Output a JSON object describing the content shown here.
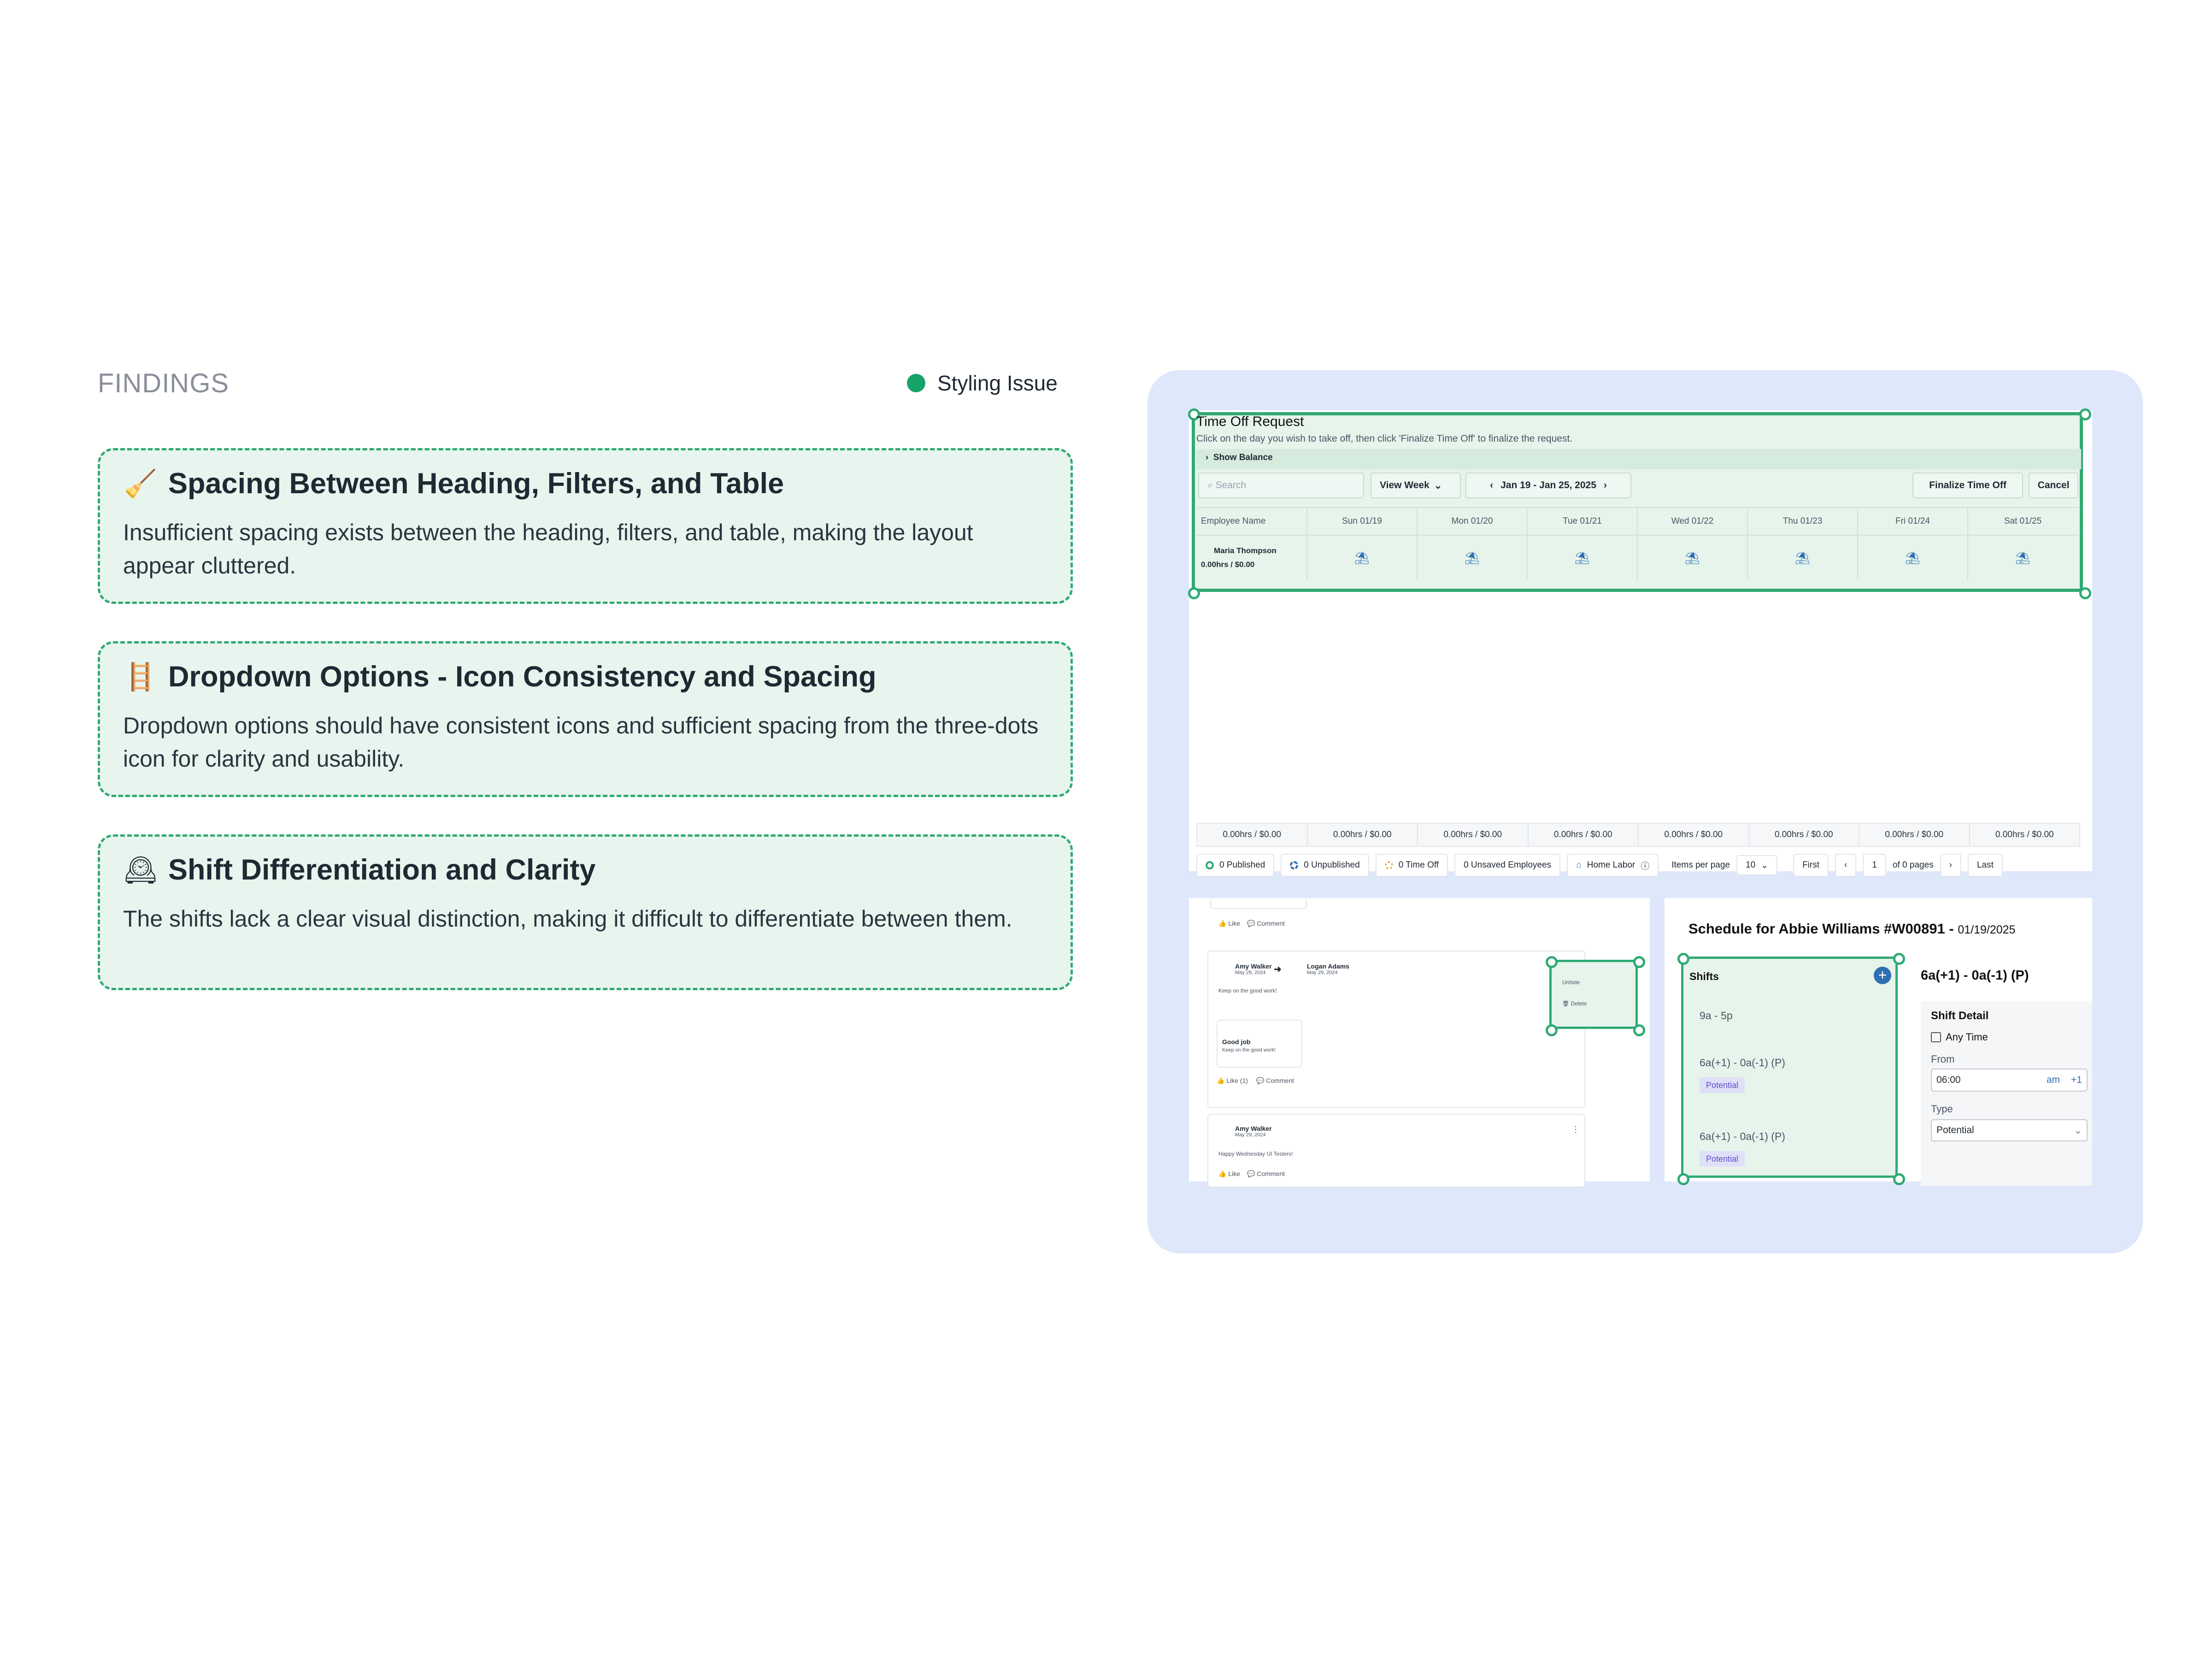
{
  "findings": {
    "heading": "FINDINGS",
    "legend": {
      "label": "Styling Issue",
      "color": "#16a36a"
    },
    "items": [
      {
        "icon": "broom-icon",
        "emoji": "🧹",
        "title": "Spacing Between Heading, Filters, and Table",
        "description": "Insufficient spacing exists between the heading, filters, and table, making the layout appear cluttered."
      },
      {
        "icon": "ladder-icon",
        "emoji": "🪜",
        "title": "Dropdown Options - Icon Consistency and Spacing",
        "description": "Dropdown options should have consistent icons and sufficient spacing from the three-dots icon for clarity and usability."
      },
      {
        "icon": "clock-icon",
        "emoji": "🕰",
        "title": "Shift Differentiation and Clarity",
        "description": "The shifts lack a clear visual distinction, making it difficult to differentiate between them."
      }
    ]
  },
  "time_off": {
    "title": "Time Off Request",
    "subtitle": "Click on the day you wish to take off, then click 'Finalize Time Off' to finalize the request.",
    "show_balance": "Show Balance",
    "search_placeholder": "Search",
    "view": "View Week",
    "date_range": "Jan 19 - Jan 25, 2025",
    "finalize": "Finalize Time Off",
    "cancel": "Cancel",
    "columns": [
      "Employee Name",
      "Sun 01/19",
      "Mon 01/20",
      "Tue 01/21",
      "Wed 01/22",
      "Thu 01/23",
      "Fri 01/24",
      "Sat 01/25"
    ],
    "employee": {
      "name": "Maria Thompson",
      "total": "0.00hrs / $0.00"
    },
    "totals": [
      "0.00hrs / $0.00",
      "0.00hrs / $0.00",
      "0.00hrs / $0.00",
      "0.00hrs / $0.00",
      "0.00hrs / $0.00",
      "0.00hrs / $0.00",
      "0.00hrs / $0.00",
      "0.00hrs / $0.00"
    ],
    "status": {
      "published": "0 Published",
      "unpublished": "0 Unpublished",
      "time_off": "0 Time Off",
      "unsaved": "0 Unsaved Employees",
      "home_labor": "Home Labor",
      "items_per_page_label": "Items per page",
      "items_per_page": "10",
      "first": "First",
      "page": "1",
      "of_pages": "of 0 pages",
      "last": "Last"
    }
  },
  "feed": {
    "like": "Like",
    "comment": "Comment",
    "post1": {
      "author": "Amy Walker",
      "date": "May 29, 2024",
      "recipient": "Logan Adams",
      "recipient_date": "May 29, 2024",
      "text": "Keep on the good work!",
      "card_title": "Good job",
      "card_text": "Keep on the good work!",
      "like_count": "Like (1)"
    },
    "post2": {
      "author": "Amy Walker",
      "date": "May 29, 2024",
      "text": "Happy Wednesday UI Testers!"
    },
    "menu": {
      "unhide": "Unhide",
      "delete": "Delete"
    }
  },
  "schedule": {
    "title": "Schedule for Abbie Williams #W00891 -",
    "date": "01/19/2025",
    "shifts_label": "Shifts",
    "shifts": [
      {
        "label": "9a - 5p",
        "badge": ""
      },
      {
        "label": "6a(+1) - 0a(-1) (P)",
        "badge": "Potential"
      },
      {
        "label": "6a(+1) - 0a(-1) (P)",
        "badge": "Potential"
      }
    ],
    "detail": {
      "heading": "6a(+1) - 0a(-1) (P)",
      "section": "Shift Detail",
      "any_time": "Any Time",
      "from_label": "From",
      "from_value": "06:00",
      "am": "am",
      "plus_one": "+1",
      "type_label": "Type",
      "type_value": "Potential"
    }
  }
}
